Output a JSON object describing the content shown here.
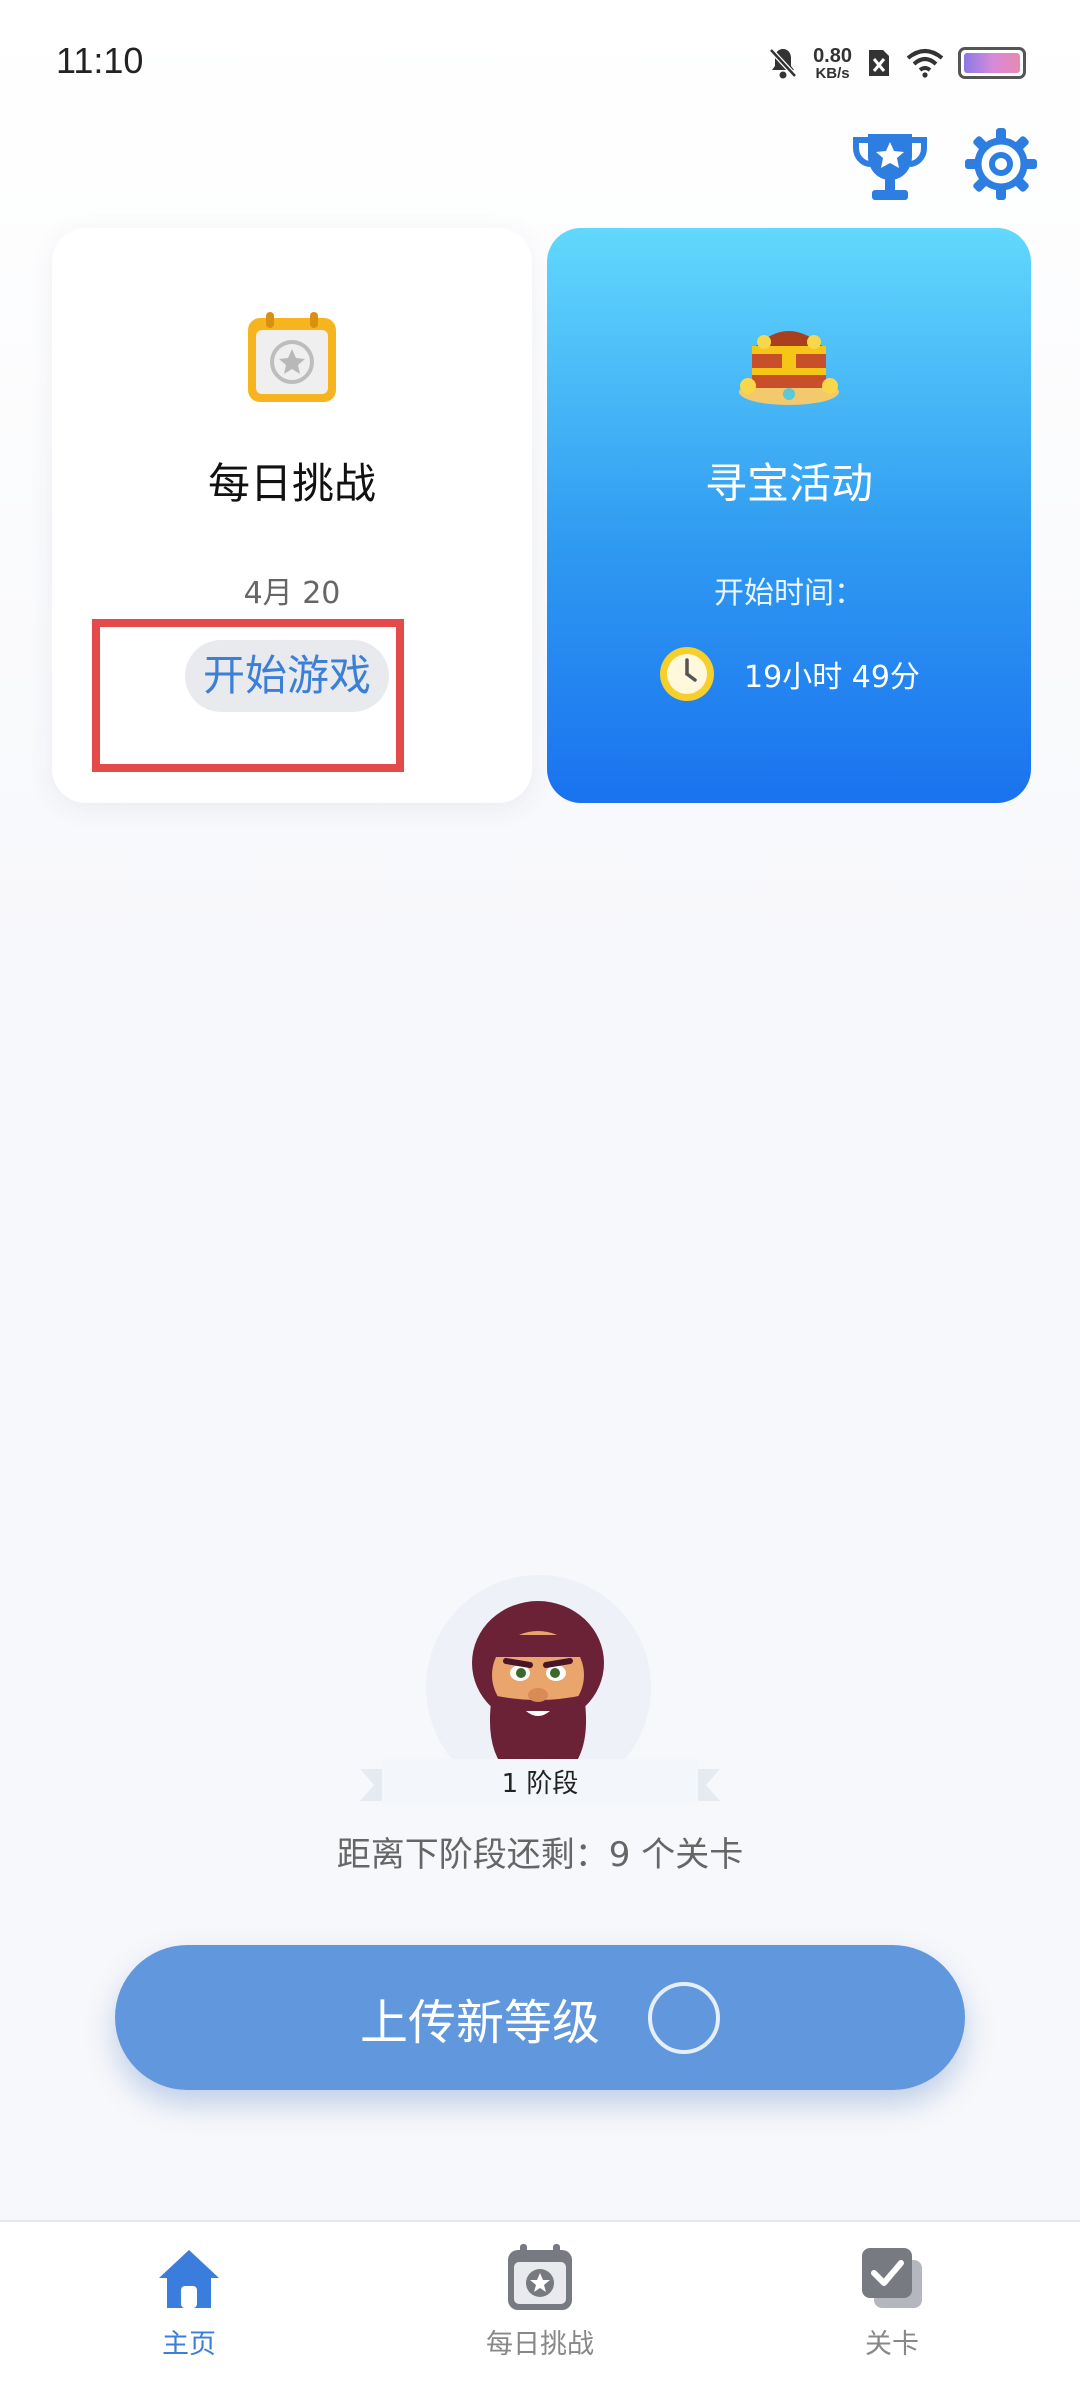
{
  "status_bar": {
    "time": "11:10",
    "net_speed_value": "0.80",
    "net_speed_unit": "KB/s",
    "icons": [
      "mute-icon",
      "sim-error-icon",
      "wifi-icon",
      "battery-icon"
    ]
  },
  "header": {
    "icons": [
      "trophy-icon",
      "gear-icon"
    ]
  },
  "daily_card": {
    "icon": "calendar-star-icon",
    "title": "每日挑战",
    "date": "4月 20",
    "button_label": "开始游戏"
  },
  "treasure_card": {
    "icon": "treasure-chest-icon",
    "title": "寻宝活动",
    "start_label": "开始时间：",
    "countdown": "19小时 49分"
  },
  "level": {
    "stage_label": "1 阶段",
    "remaining_text": "距离下阶段还剩：9 个关卡"
  },
  "upload_button": {
    "label": "上传新等级"
  },
  "bottom_nav": {
    "items": [
      {
        "label": "主页",
        "icon": "home-icon",
        "active": true
      },
      {
        "label": "每日挑战",
        "icon": "calendar-icon",
        "active": false
      },
      {
        "label": "关卡",
        "icon": "levels-icon",
        "active": false
      }
    ]
  },
  "colors": {
    "accent": "#3a7ddc",
    "upload_button": "#6097dd",
    "treasure_card_top": "#62d8fd",
    "treasure_card_bottom": "#1a72ef",
    "highlight": "#e44a4a"
  }
}
